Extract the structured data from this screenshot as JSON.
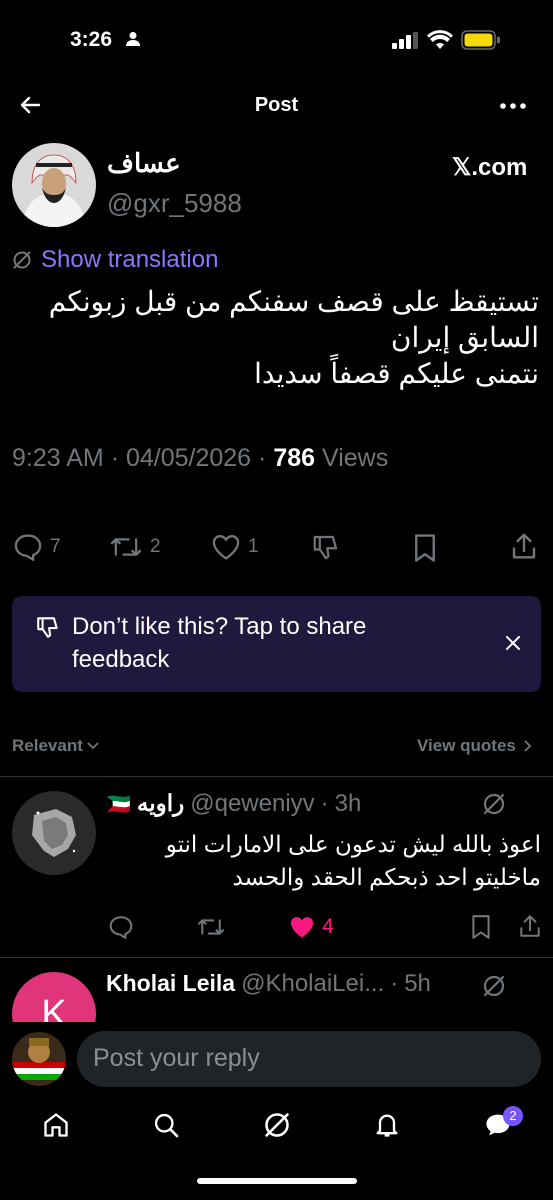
{
  "status_bar": {
    "time": "3:26"
  },
  "header": {
    "title": "Post"
  },
  "tweet": {
    "author_name": "عساف",
    "author_handle": "@gxr_5988",
    "source": "𝕏.com",
    "show_translation": "Show translation",
    "text_lines": [
      "تستيقظ على قصف سفنكم من قبل زبونكم",
      "السابق إيران",
      "نتمنى عليكم  قصفاً سديدا"
    ],
    "time": "9:23 AM",
    "date": "04/05/2026",
    "views_count": "786",
    "views_label": "Views",
    "separator": "·",
    "replies": "7",
    "reposts": "2",
    "likes": "1"
  },
  "feedback_banner": {
    "text": "Don’t like this? Tap to share feedback"
  },
  "sort": {
    "label": "Relevant",
    "view_quotes": "View quotes"
  },
  "replies": [
    {
      "flag": "🇰🇼",
      "name": "راويه",
      "handle": "@qeweniyv",
      "time": "3h",
      "text_lines": [
        "اعوذ بالله ليش تدعون على الامارات انتو",
        "ماخليتو احد ذبحكم الحقد والحسد"
      ],
      "likes": "4"
    },
    {
      "avatar_letter": "K",
      "name": "Kholai Leila",
      "handle": "@KholaiLei...",
      "time": "5h"
    }
  ],
  "compose": {
    "placeholder": "Post your reply"
  },
  "bottom_nav": {
    "messages_badge": "2"
  },
  "colors": {
    "accent": "#8a76ff",
    "like_pink": "#f91880",
    "banner_bg": "#21183d",
    "muted": "#71767b"
  }
}
